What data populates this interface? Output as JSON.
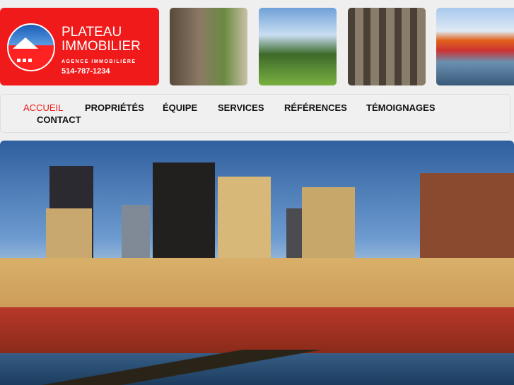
{
  "logo": {
    "line1": "PLATEAU",
    "line2": "IMMOBILIER",
    "tagline": "AGENCE IMMOBILIÈRE",
    "phone": "514-787-1234"
  },
  "nav": {
    "items": [
      {
        "label": "ACCUEIL",
        "active": true
      },
      {
        "label": "PROPRIÉTÉS"
      },
      {
        "label": "ÉQUIPE"
      },
      {
        "label": "SERVICES"
      },
      {
        "label": "RÉFÉRENCES"
      },
      {
        "label": "TÉMOIGNAGES"
      },
      {
        "label": "CONTACT"
      }
    ]
  },
  "colors": {
    "brand": "#f01a1a"
  }
}
